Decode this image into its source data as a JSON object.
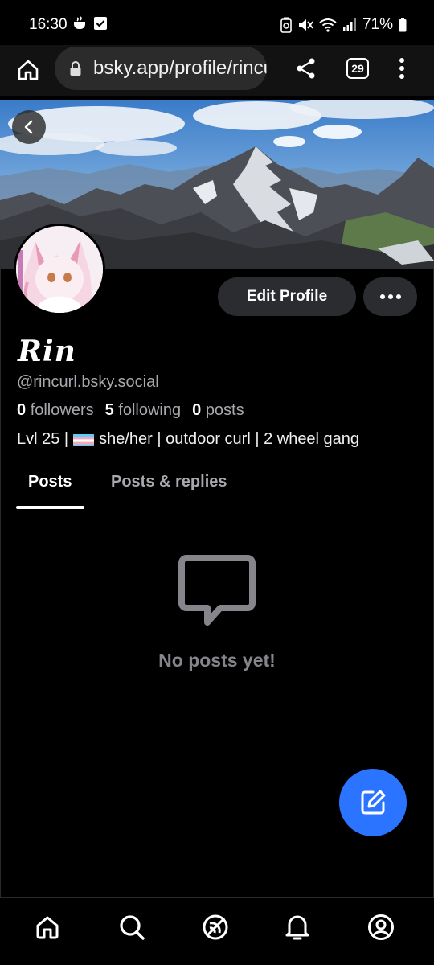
{
  "status_bar": {
    "time": "16:30",
    "battery": "71%"
  },
  "browser": {
    "url": "bsky.app/profile/rincurl.bsky.social",
    "tab_count": "29"
  },
  "profile": {
    "display_name": "Rin",
    "handle": "@rincurl.bsky.social",
    "followers_count": "0",
    "followers_label": "followers",
    "following_count": "5",
    "following_label": "following",
    "posts_count": "0",
    "posts_label": "posts",
    "bio_prefix": "Lvl 25 |",
    "bio_suffix": "she/her | outdoor curl | 2 wheel gang"
  },
  "buttons": {
    "edit_profile": "Edit Profile"
  },
  "tabs": [
    {
      "label": "Posts",
      "active": true
    },
    {
      "label": "Posts & replies",
      "active": false
    }
  ],
  "empty_state": {
    "message": "No posts yet!",
    "icon": "message-square-icon"
  },
  "colors": {
    "accent": "#2b74ff",
    "background": "#000000",
    "muted_text": "#a8a8ae"
  },
  "bottom_nav": [
    {
      "icon": "home-icon"
    },
    {
      "icon": "search-icon"
    },
    {
      "icon": "feeds-icon"
    },
    {
      "icon": "notifications-icon"
    },
    {
      "icon": "profile-icon"
    }
  ]
}
